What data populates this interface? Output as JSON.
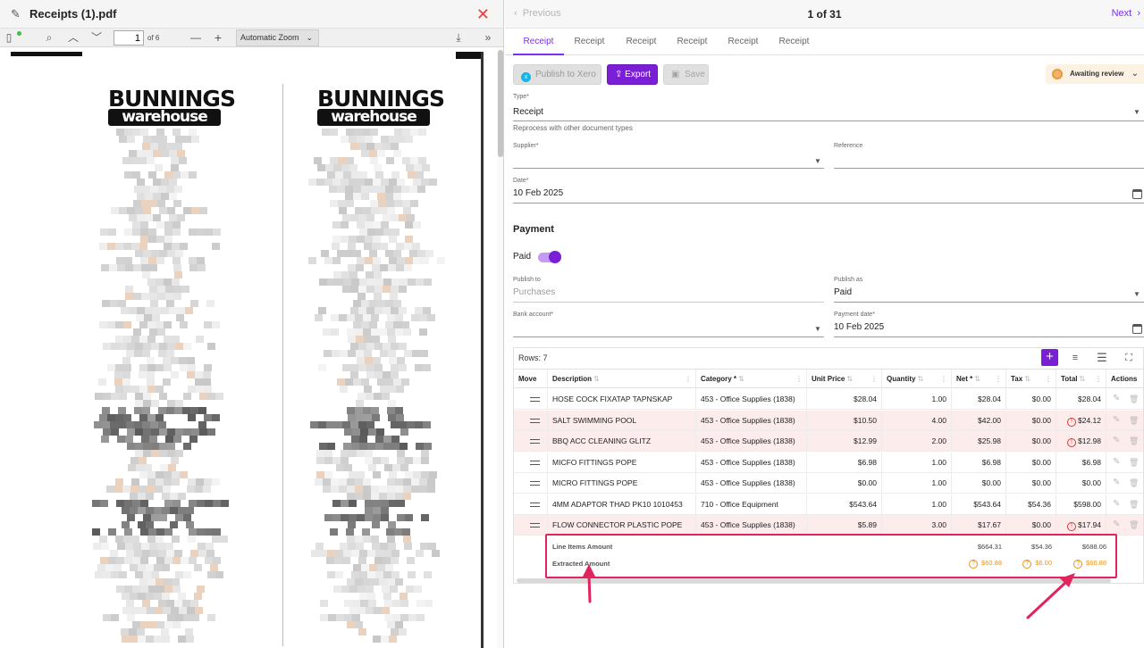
{
  "pdf": {
    "file_name": "Receipts (1).pdf",
    "page_number": "1",
    "page_total": "of 6",
    "zoom": "Automatic Zoom",
    "receipt_logo_line1": "BUNNINGS",
    "receipt_logo_line2": "warehouse"
  },
  "nav": {
    "previous": "Previous",
    "counter": "1 of 31",
    "next": "Next"
  },
  "tabs": [
    "Receipt",
    "Receipt",
    "Receipt",
    "Receipt",
    "Receipt",
    "Receipt"
  ],
  "actions": {
    "publish_xero": "Publish to Xero",
    "export": "Export",
    "save": "Save",
    "status": "Awaiting review"
  },
  "form": {
    "type_label": "Type",
    "type_value": "Receipt",
    "reprocess_help": "Reprocess with other document types",
    "supplier_label": "Supplier",
    "supplier_value": "",
    "reference_label": "Reference",
    "reference_value": "",
    "date_label": "Date",
    "date_value": "10 Feb 2025",
    "payment_heading": "Payment",
    "paid_label": "Paid",
    "paid_on": true,
    "publish_to_label": "Publish to",
    "publish_to_value": "Purchases",
    "publish_as_label": "Publish as",
    "publish_as_value": "Paid",
    "bank_account_label": "Bank account",
    "bank_account_value": "",
    "payment_date_label": "Payment date",
    "payment_date_value": "10 Feb 2025",
    "required_mark": "*"
  },
  "grid": {
    "rows_label": "Rows: 7",
    "columns": [
      "Move",
      "Description",
      "Category *",
      "Unit Price",
      "Quantity",
      "Net *",
      "Tax",
      "Total",
      "Actions"
    ],
    "rows": [
      {
        "description": "HOSE COCK FIXATAP TAPNSKAP",
        "category": "453 - Office Supplies (1838)",
        "unit_price": "$28.04",
        "quantity": "1.00",
        "net": "$28.04",
        "tax": "$0.00",
        "total": "$28.04",
        "error": false
      },
      {
        "description": "SALT SWIMMING POOL",
        "category": "453 - Office Supplies (1838)",
        "unit_price": "$10.50",
        "quantity": "4.00",
        "net": "$42.00",
        "tax": "$0.00",
        "total": "$24.12",
        "error": true
      },
      {
        "description": "BBQ ACC CLEANING GLITZ",
        "category": "453 - Office Supplies (1838)",
        "unit_price": "$12.99",
        "quantity": "2.00",
        "net": "$25.98",
        "tax": "$0.00",
        "total": "$12.98",
        "error": true
      },
      {
        "description": "MICFO FITTINGS POPE",
        "category": "453 - Office Supplies (1838)",
        "unit_price": "$6.98",
        "quantity": "1.00",
        "net": "$6.98",
        "tax": "$0.00",
        "total": "$6.98",
        "error": false
      },
      {
        "description": "MICRO FITTINGS POPE",
        "category": "453 - Office Supplies (1838)",
        "unit_price": "$0.00",
        "quantity": "1.00",
        "net": "$0.00",
        "tax": "$0.00",
        "total": "$0.00",
        "error": false
      },
      {
        "description": "4MM ADAPTOR THAD PK10 1010453",
        "category": "710 - Office Equipment",
        "unit_price": "$543.64",
        "quantity": "1.00",
        "net": "$543.64",
        "tax": "$54.36",
        "total": "$598.00",
        "error": false
      },
      {
        "description": "FLOW CONNECTOR PLASTIC POPE",
        "category": "453 - Office Supplies (1838)",
        "unit_price": "$5.89",
        "quantity": "3.00",
        "net": "$17.67",
        "tax": "$0.00",
        "total": "$17.94",
        "error": true
      }
    ],
    "summary": {
      "line_items_label": "Line Items Amount",
      "line_items_net": "$664.31",
      "line_items_tax": "$54.36",
      "line_items_total": "$688.06",
      "extracted_label": "Extracted Amount",
      "extracted_net": "$60.88",
      "extracted_tax": "$6.00",
      "extracted_total": "$66.88"
    }
  },
  "colors": {
    "accent": "#7b1fd6",
    "error_row": "#fdecec",
    "warning": "#e8941f",
    "annotation": "#e0245e"
  }
}
